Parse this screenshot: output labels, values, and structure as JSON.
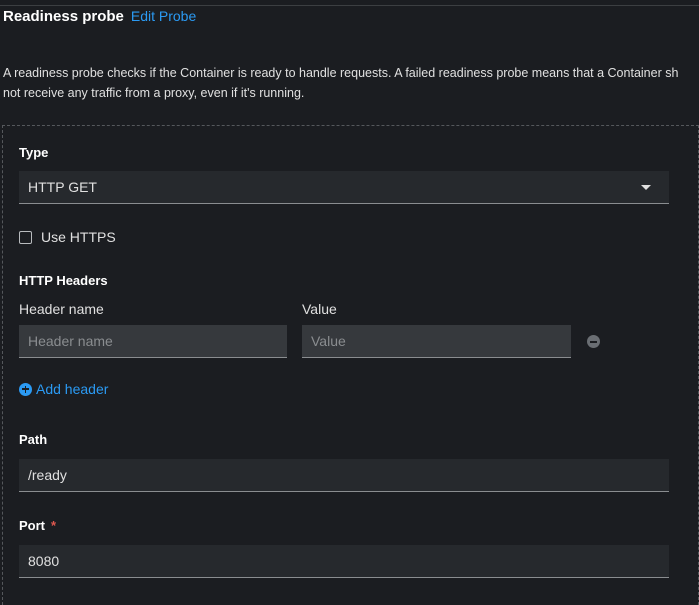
{
  "header": {
    "title": "Readiness probe",
    "edit_link": "Edit Probe"
  },
  "description": {
    "line1": "A readiness probe checks if the Container is ready to handle requests. A failed readiness probe means that a Container sh",
    "line2": "not receive any traffic from a proxy, even if it's running."
  },
  "type": {
    "label": "Type",
    "selected": "HTTP GET"
  },
  "https": {
    "label": "Use HTTPS",
    "checked": false
  },
  "headers": {
    "section_label": "HTTP Headers",
    "name_label": "Header name",
    "value_label": "Value",
    "name_placeholder": "Header name",
    "value_placeholder": "Value",
    "add_label": "Add header"
  },
  "path": {
    "label": "Path",
    "value": "/ready"
  },
  "port": {
    "label": "Port",
    "required_mark": "*",
    "value": "8080"
  }
}
